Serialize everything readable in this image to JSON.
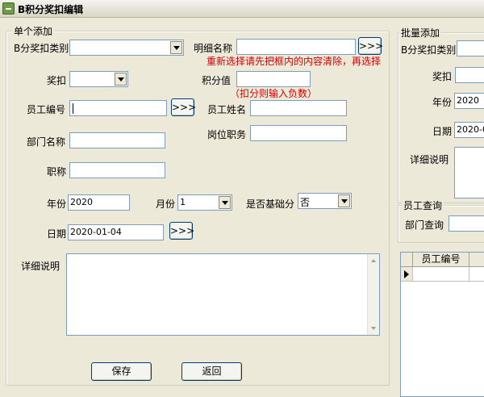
{
  "window": {
    "title": "B积分奖扣编辑"
  },
  "single": {
    "legend": "单个添加",
    "category_label": "B分奖扣类别",
    "category_value": "",
    "detail_label": "明细名称",
    "detail_value": "",
    "detail_btn": ">>>",
    "detail_hint": "重新选择请先把框内的内容清除，再选择",
    "reward_label": "奖扣",
    "reward_value": "",
    "points_label": "积分值",
    "points_value": "",
    "points_hint": "（扣分则输入负数）",
    "emp_no_label": "员工编号",
    "emp_no_value": "",
    "emp_btn": ">>>",
    "emp_name_label": "员工姓名",
    "emp_name_value": "",
    "dept_label": "部门名称",
    "dept_value": "",
    "position_label": "岗位职务",
    "position_value": "",
    "title_label": "职称",
    "title_value": "",
    "year_label": "年份",
    "year_value": "2020",
    "month_label": "月份",
    "month_value": "1",
    "basic_label": "是否基础分",
    "basic_value": "否",
    "date_label": "日期",
    "date_value": "2020-01-04",
    "date_btn": ">>>",
    "desc_label": "详细说明",
    "desc_value": "",
    "save_btn": "保存",
    "back_btn": "返回"
  },
  "batch": {
    "legend": "批量添加",
    "category_label": "B分奖扣类别",
    "reward_label": "奖扣",
    "year_label": "年份",
    "year_value": "2020",
    "date_label": "日期",
    "date_value": "2020-0",
    "desc_label": "详细说明"
  },
  "query": {
    "legend": "员工查询",
    "dept_label": "部门查询"
  },
  "grid": {
    "columns": [
      "员工编号"
    ]
  },
  "colors": {
    "hint": "#d40000",
    "background": "#ECE9D8",
    "input_border": "#7f9db9"
  },
  "icons": [
    "window-icon",
    "dropdown-arrow-icon",
    "row-indicator-icon",
    "scroll-up-icon",
    "scroll-down-icon"
  ]
}
